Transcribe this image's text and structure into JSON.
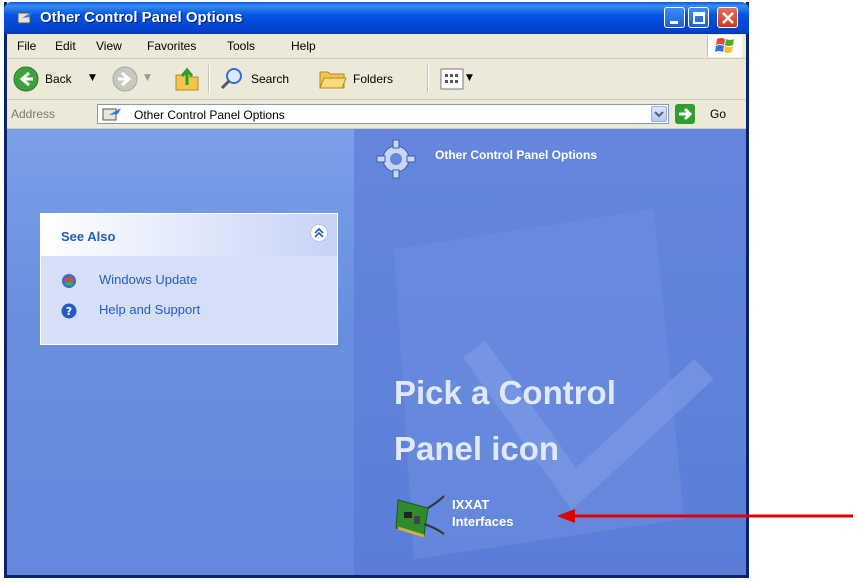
{
  "window": {
    "title": "Other Control Panel Options"
  },
  "menubar": {
    "items": [
      "File",
      "Edit",
      "View",
      "Favorites",
      "Tools",
      "Help"
    ]
  },
  "toolbar": {
    "back_label": "Back",
    "search_label": "Search",
    "folders_label": "Folders"
  },
  "address": {
    "label": "Address",
    "value": "Other Control Panel Options",
    "go_label": "Go"
  },
  "see_also": {
    "title": "See Also",
    "links": [
      {
        "label": "Windows Update",
        "icon": "windows-update-icon"
      },
      {
        "label": "Help and Support",
        "icon": "help-icon"
      }
    ]
  },
  "content": {
    "header_title": "Other Control Panel Options",
    "pick_line1": "Pick a Control",
    "pick_line2": "Panel icon",
    "item_line1": "IXXAT",
    "item_line2": "Interfaces"
  },
  "colors": {
    "title_bar": "#0055E5",
    "task_pane": "#6A8FDF",
    "link": "#215DC6",
    "annotation_arrow": "#E00000"
  }
}
